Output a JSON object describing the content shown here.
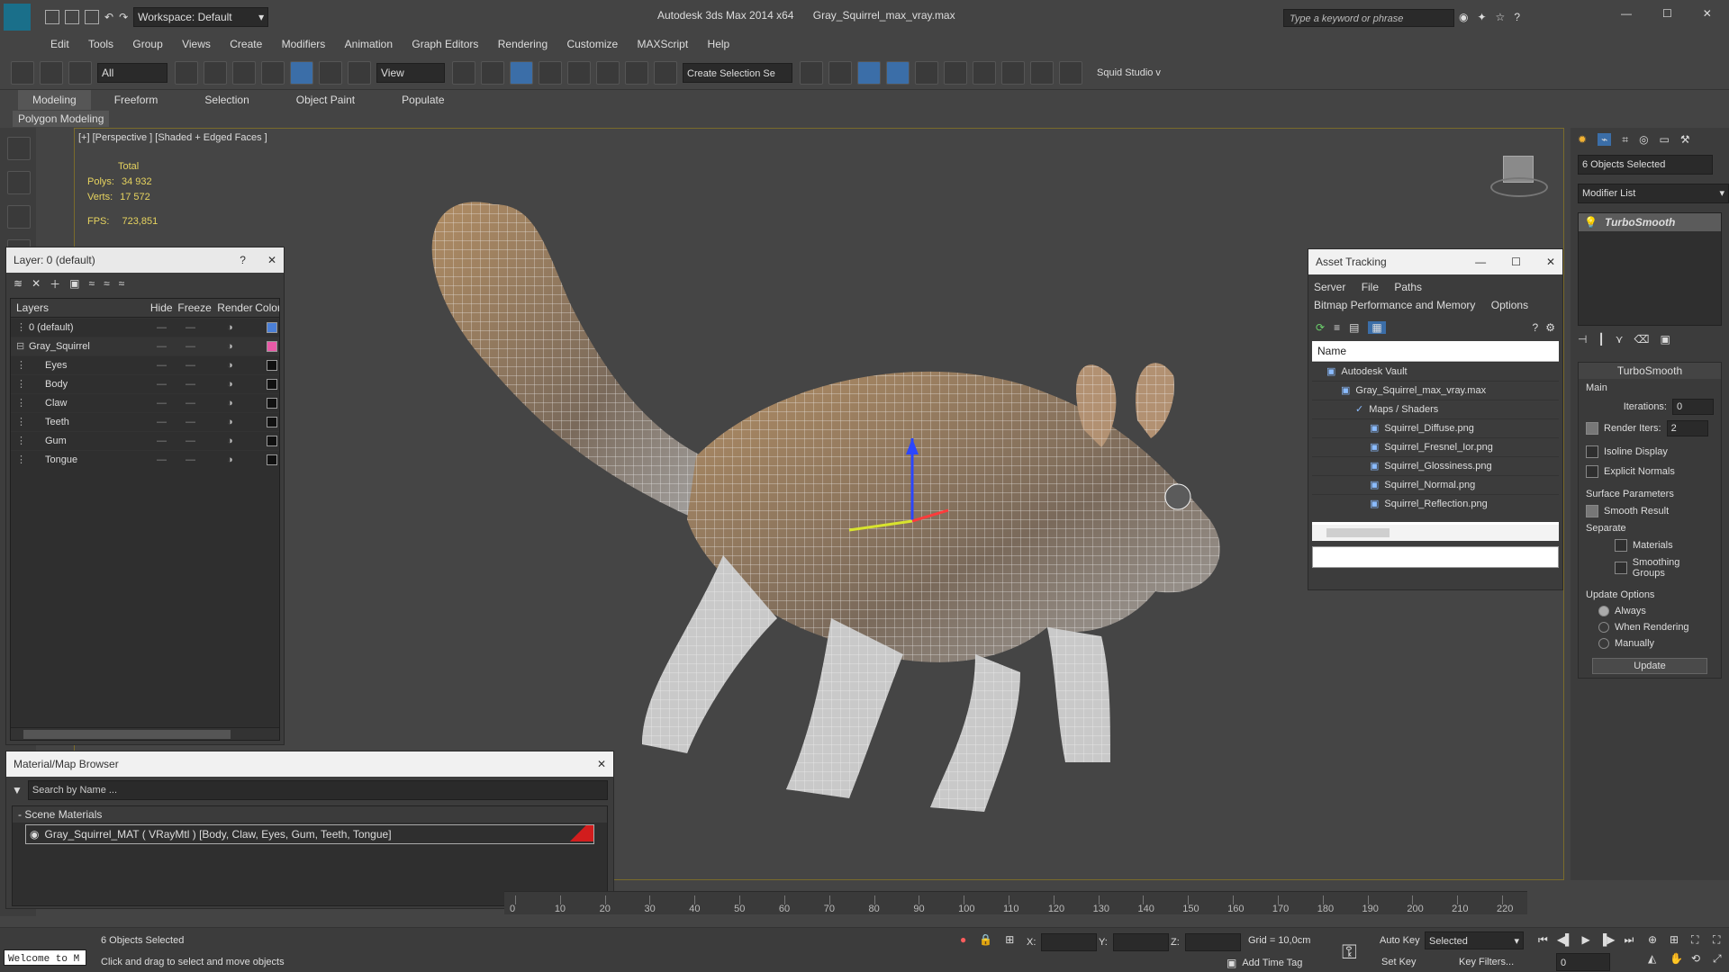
{
  "app": {
    "title": "Autodesk 3ds Max  2014 x64",
    "file": "Gray_Squirrel_max_vray.max",
    "workspace_label": "Workspace: Default",
    "search_placeholder": "Type a keyword or phrase"
  },
  "menubar": [
    "Edit",
    "Tools",
    "Group",
    "Views",
    "Create",
    "Modifiers",
    "Animation",
    "Graph Editors",
    "Rendering",
    "Customize",
    "MAXScript",
    "Help"
  ],
  "toolbar": {
    "filter_value": "All",
    "view_value": "View",
    "selection_set_value": "Create Selection Se",
    "studio_label": "Squid Studio v"
  },
  "ribbon": {
    "tabs": [
      "Modeling",
      "Freeform",
      "Selection",
      "Object Paint",
      "Populate"
    ],
    "subtab": "Polygon Modeling"
  },
  "viewport": {
    "label": "[+] [Perspective ] [Shaded + Edged Faces ]",
    "stats": {
      "total_label": "Total",
      "polys_label": "Polys:",
      "polys_value": "34 932",
      "verts_label": "Verts:",
      "verts_value": "17 572",
      "fps_label": "FPS:",
      "fps_value": "723,851"
    }
  },
  "layer_panel": {
    "title": "Layer: 0 (default)",
    "help": "?",
    "columns": [
      "Layers",
      "Hide",
      "Freeze",
      "Render",
      "Color"
    ],
    "rows": [
      {
        "name": "0 (default)",
        "color": "#4b7fd6"
      },
      {
        "name": "Gray_Squirrel",
        "color": "#e85aa6"
      },
      {
        "name": "Eyes",
        "color": "#111111"
      },
      {
        "name": "Body",
        "color": "#111111"
      },
      {
        "name": "Claw",
        "color": "#111111"
      },
      {
        "name": "Teeth",
        "color": "#111111"
      },
      {
        "name": "Gum",
        "color": "#111111"
      },
      {
        "name": "Tongue",
        "color": "#111111"
      }
    ]
  },
  "asset_tracking": {
    "title": "Asset Tracking",
    "menu": [
      "Server",
      "File",
      "Paths"
    ],
    "menu2": [
      "Bitmap Performance and Memory",
      "Options"
    ],
    "col_name": "Name",
    "tree": [
      {
        "label": "Autodesk Vault",
        "indent": 1
      },
      {
        "label": "Gray_Squirrel_max_vray.max",
        "indent": 2
      },
      {
        "label": "Maps / Shaders",
        "indent": 3
      },
      {
        "label": "Squirrel_Diffuse.png",
        "indent": 4
      },
      {
        "label": "Squirrel_Fresnel_Ior.png",
        "indent": 4
      },
      {
        "label": "Squirrel_Glossiness.png",
        "indent": 4
      },
      {
        "label": "Squirrel_Normal.png",
        "indent": 4
      },
      {
        "label": "Squirrel_Reflection.png",
        "indent": 4
      }
    ]
  },
  "material_browser": {
    "title": "Material/Map Browser",
    "search_placeholder": "Search by Name ...",
    "section": "- Scene Materials",
    "material": "Gray_Squirrel_MAT ( VRayMtl ) [Body, Claw, Eyes, Gum, Teeth, Tongue]"
  },
  "right_panel": {
    "selection_label": "6 Objects Selected",
    "modifier_list": "Modifier List",
    "stack_item": "TurboSmooth",
    "rollout_title": "TurboSmooth",
    "main_label": "Main",
    "iterations_label": "Iterations:",
    "iterations_value": "0",
    "render_iters_label": "Render Iters:",
    "render_iters_value": "2",
    "isoline_label": "Isoline Display",
    "explicit_label": "Explicit Normals",
    "surface_label": "Surface Parameters",
    "smooth_result_label": "Smooth Result",
    "separate_label": "Separate",
    "materials_label": "Materials",
    "smoothing_groups_label": "Smoothing Groups",
    "update_options_label": "Update Options",
    "always_label": "Always",
    "when_rendering_label": "When Rendering",
    "manually_label": "Manually",
    "update_button": "Update"
  },
  "timeline": {
    "ticks": [
      0,
      10,
      20,
      30,
      40,
      50,
      60,
      70,
      80,
      90,
      100,
      110,
      120,
      130,
      140,
      150,
      160,
      170,
      180,
      190,
      200,
      210,
      220
    ]
  },
  "status": {
    "maxscript": "Welcome to M",
    "selection": "6 Objects Selected",
    "hint": "Click and drag to select and move objects",
    "x_label": "X:",
    "y_label": "Y:",
    "z_label": "Z:",
    "grid": "Grid = 10,0cm",
    "add_time_tag": "Add Time Tag",
    "auto_key": "Auto Key",
    "set_key": "Set Key",
    "selected_value": "Selected",
    "key_filters": "Key Filters...",
    "frame_value": "0"
  }
}
